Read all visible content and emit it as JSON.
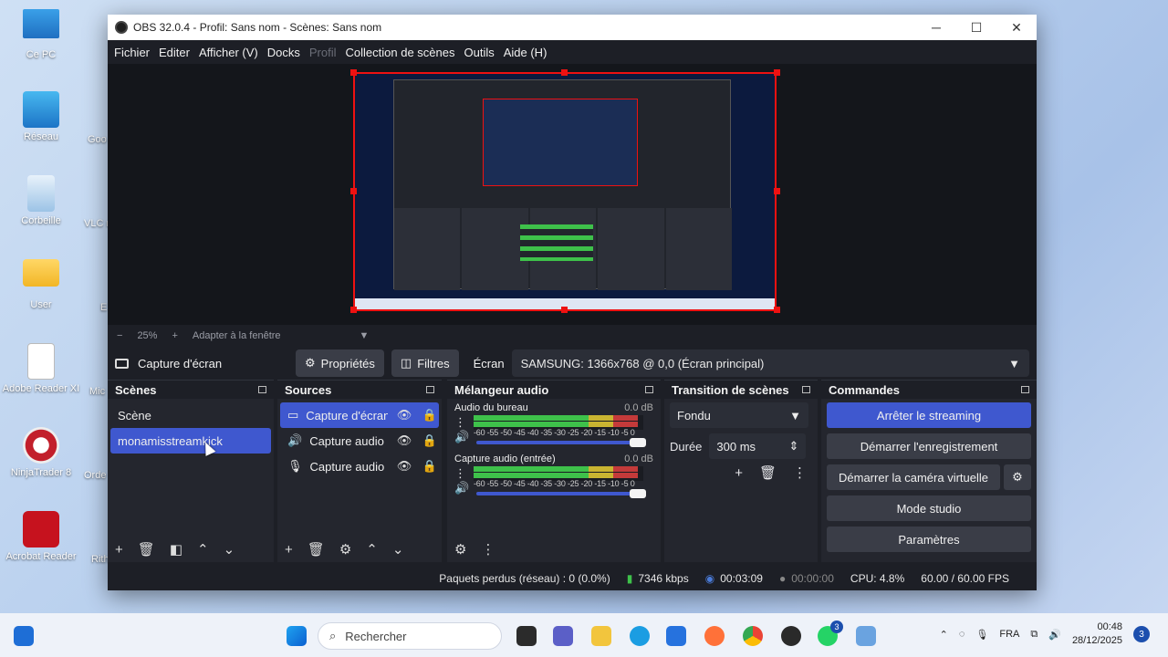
{
  "desktop": {
    "icons": [
      {
        "label": "Ce PC",
        "icon": "monitor-icon"
      },
      {
        "label": "Réseau",
        "icon": "network-icon"
      },
      {
        "label": "Corbeille",
        "icon": "recycle-bin-icon"
      },
      {
        "label": "User",
        "icon": "folder-icon"
      },
      {
        "label": "Adobe Reader XI",
        "icon": "document-icon"
      },
      {
        "label": "NinjaTrader 8",
        "icon": "ninjatrader-icon"
      },
      {
        "label": "Acrobat Reader",
        "icon": "acrobat-icon"
      }
    ],
    "partial_labels": [
      "Goo",
      "VLC m",
      "E",
      "Mic",
      "Orde",
      "Rith"
    ]
  },
  "window": {
    "title": "OBS 32.0.4 - Profil: Sans nom - Scènes: Sans nom",
    "minimize": "─",
    "maximize": "☐",
    "close": "✕"
  },
  "menu": {
    "items": [
      "Fichier",
      "Editer",
      "Afficher (V)",
      "Docks",
      "Profil",
      "Collection de scènes",
      "Outils",
      "Aide (H)"
    ]
  },
  "preview": {
    "zoom_minus": "−",
    "zoom": "25%",
    "zoom_plus": "+",
    "fit": "Adapter à la fenêtre",
    "caret": "▼"
  },
  "source_bar": {
    "title": "Capture d'écran",
    "properties": "Propriétés",
    "filters": "Filtres",
    "screen_label": "Écran",
    "screen_value": "SAMSUNG: 1366x768 @ 0,0 (Écran principal)",
    "dropdown": "▼"
  },
  "scenes": {
    "title": "Scènes",
    "items": [
      "Scène",
      "monamisstreamkick"
    ],
    "selected": "monamisstreamkick",
    "footer": [
      "+",
      "🗑",
      "◧",
      "⌃",
      "⌄"
    ]
  },
  "sources": {
    "title": "Sources",
    "items": [
      {
        "name": "Capture d'écran",
        "icon": "monitor-icon"
      },
      {
        "name": "Capture audio (so",
        "icon": "speaker-icon"
      },
      {
        "name": "Capture audio (e",
        "icon": "microphone-icon"
      }
    ],
    "footer": [
      "+",
      "🗑",
      "⚙",
      "⌃",
      "⌄"
    ]
  },
  "mixer": {
    "title": "Mélangeur audio",
    "scale": "-60 -55 -50 -45 -40 -35 -30 -25 -20 -15 -10 -5 0",
    "channels": [
      {
        "name": "Audio du bureau",
        "db": "0.0 dB",
        "level": 0.97
      },
      {
        "name": "Capture audio (entrée)",
        "db": "0.0 dB",
        "level": 0.97
      }
    ],
    "footer": [
      "⚙",
      "⋮"
    ]
  },
  "transition": {
    "title": "Transition de scènes",
    "type": "Fondu",
    "duration_label": "Durée",
    "duration": "300 ms",
    "footer": [
      "+",
      "🗑",
      "⋮"
    ]
  },
  "controls": {
    "title": "Commandes",
    "stop_streaming": "Arrêter le streaming",
    "start_recording": "Démarrer l'enregistrement",
    "virtual_cam": "Démarrer la caméra virtuelle",
    "studio_mode": "Mode studio",
    "settings": "Paramètres"
  },
  "status": {
    "dropped": "Paquets perdus (réseau) : 0 (0.0%)",
    "bitrate": "7346 kbps",
    "stream_time": "00:03:09",
    "rec_time": "00:00:00",
    "cpu": "CPU: 4.8%",
    "fps": "60.00 / 60.00 FPS"
  },
  "taskbar": {
    "search": "Rechercher",
    "lang": "FRA",
    "time": "00:48",
    "date": "28/12/2025",
    "notifications": "3",
    "whatsapp_badge": "3"
  },
  "colors": {
    "accent": "#3f58cf",
    "meter_green": "#3ec14a",
    "meter_yellow": "#c9b431",
    "meter_red": "#c43a3a",
    "selection_border": "#ee1111"
  }
}
